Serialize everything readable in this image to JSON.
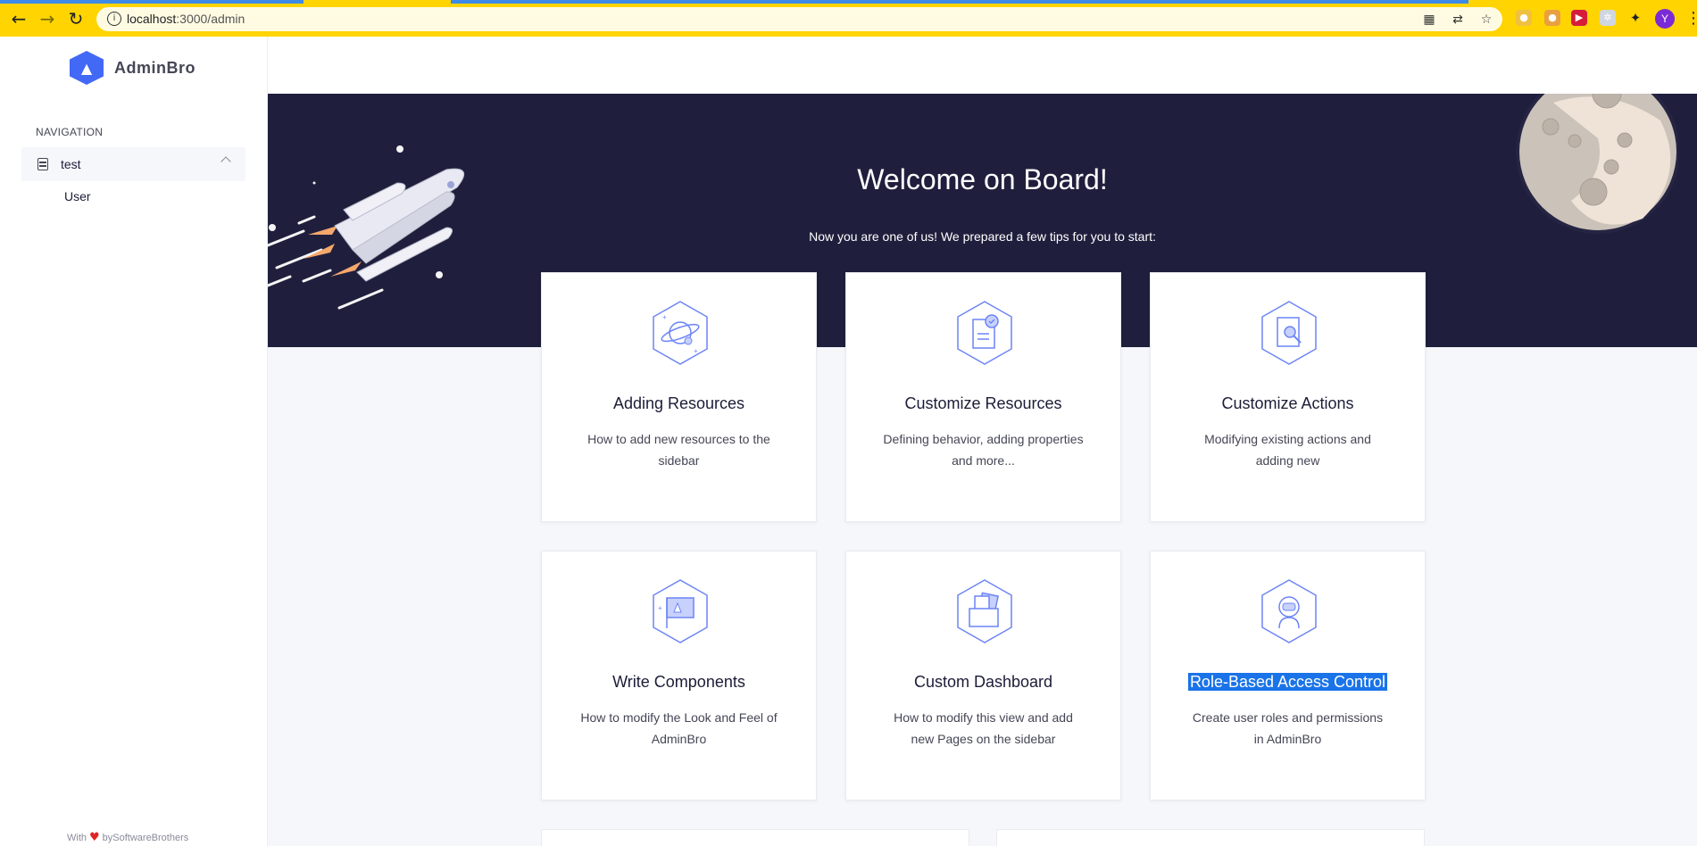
{
  "browser": {
    "url_host": "localhost",
    "url_path": ":3000/admin",
    "profile_initial": "Y"
  },
  "sidebar": {
    "brand": "AdminBro",
    "nav_title": "NAVIGATION",
    "group": {
      "label": "test",
      "icon": "database-icon"
    },
    "items": [
      {
        "label": "User"
      }
    ],
    "footer": {
      "with": "With",
      "by": "bySoftwareBrothers"
    }
  },
  "hero": {
    "title": "Welcome on Board!",
    "subtitle": "Now you are one of us! We prepared a few tips for you to start:"
  },
  "cards": [
    {
      "title": "Adding Resources",
      "desc": "How to add new resources to the sidebar",
      "icon": "planet-icon"
    },
    {
      "title": "Customize Resources",
      "desc": "Defining behavior, adding properties and more...",
      "icon": "document-check-icon"
    },
    {
      "title": "Customize Actions",
      "desc": "Modifying existing actions and adding new",
      "icon": "document-search-icon"
    },
    {
      "title": "Write Components",
      "desc": "How to modify the Look and Feel of AdminBro",
      "icon": "flag-icon"
    },
    {
      "title": "Custom Dashboard",
      "desc": "How to modify this view and add new Pages on the sidebar",
      "icon": "folder-icon"
    },
    {
      "title": "Role-Based Access Control",
      "desc": "Create user roles and permissions in AdminBro",
      "icon": "astronaut-icon"
    }
  ],
  "colors": {
    "hero_bg": "#1f1f3d",
    "brand": "#4268f6",
    "chrome": "#ffd400",
    "selection": "#1a73e8"
  }
}
